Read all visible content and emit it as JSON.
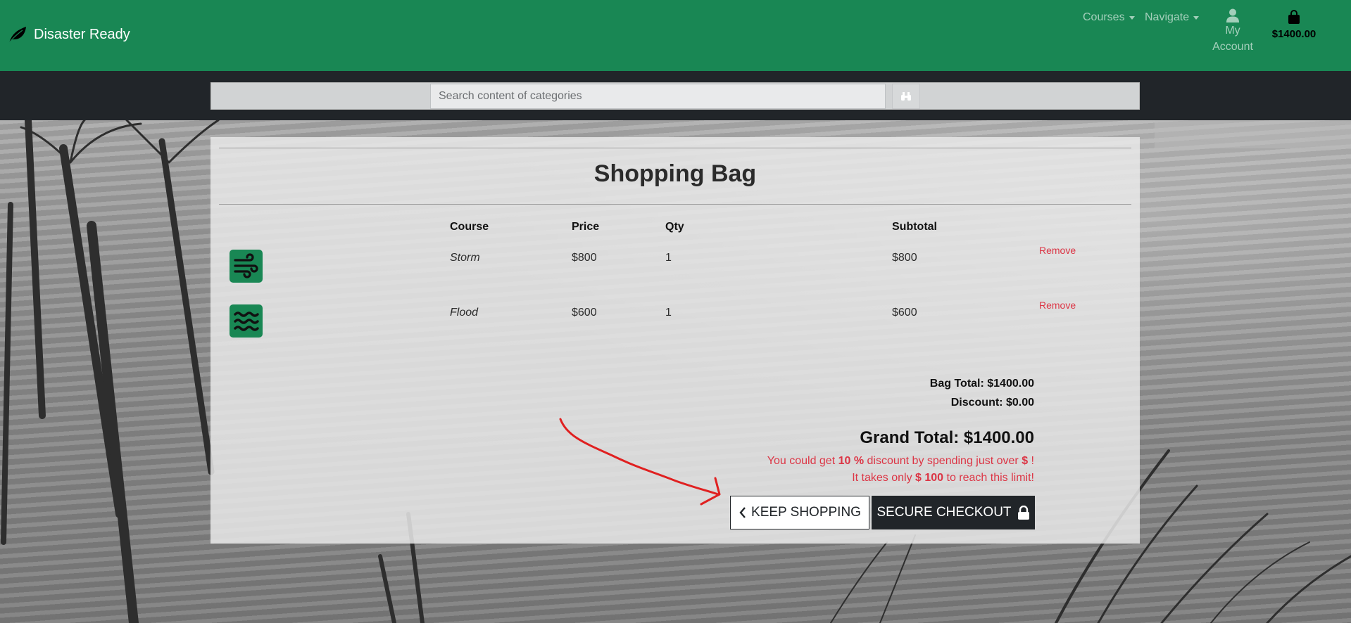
{
  "brand": {
    "name": "Disaster Ready"
  },
  "nav": {
    "courses_label": "Courses",
    "navigate_label": "Navigate",
    "account_label_line1": "My",
    "account_label_line2": "Account",
    "bag_total": "$1400.00"
  },
  "search": {
    "placeholder": "Search content of categories"
  },
  "page": {
    "title": "Shopping Bag"
  },
  "table": {
    "headers": {
      "course": "Course",
      "price": "Price",
      "qty": "Qty",
      "subtotal": "Subtotal"
    },
    "rows": [
      {
        "icon": "wind-icon",
        "course": "Storm",
        "price": "$800",
        "qty": "1",
        "subtotal": "$800",
        "remove": "Remove"
      },
      {
        "icon": "waves-icon",
        "course": "Flood",
        "price": "$600",
        "qty": "1",
        "subtotal": "$600",
        "remove": "Remove"
      }
    ]
  },
  "totals": {
    "bag_total": "Bag Total: $1400.00",
    "discount": "Discount: $0.00",
    "grand_total": "Grand Total: $1400.00"
  },
  "promo": {
    "line1_a": "You could get ",
    "line1_pct": "10 %",
    "line1_b": " discount by spending just over ",
    "line1_cur": "$",
    "line1_c": " !",
    "line2_a": "It takes only ",
    "line2_amt": "$ 100",
    "line2_b": " to reach this limit!"
  },
  "buttons": {
    "keep_shopping": "KEEP SHOPPING",
    "secure_checkout": "SECURE CHECKOUT"
  },
  "colors": {
    "navbar": "#198754",
    "searchbar": "#212529",
    "alert": "#dc3545",
    "annotation_arrow": "#e02020"
  }
}
